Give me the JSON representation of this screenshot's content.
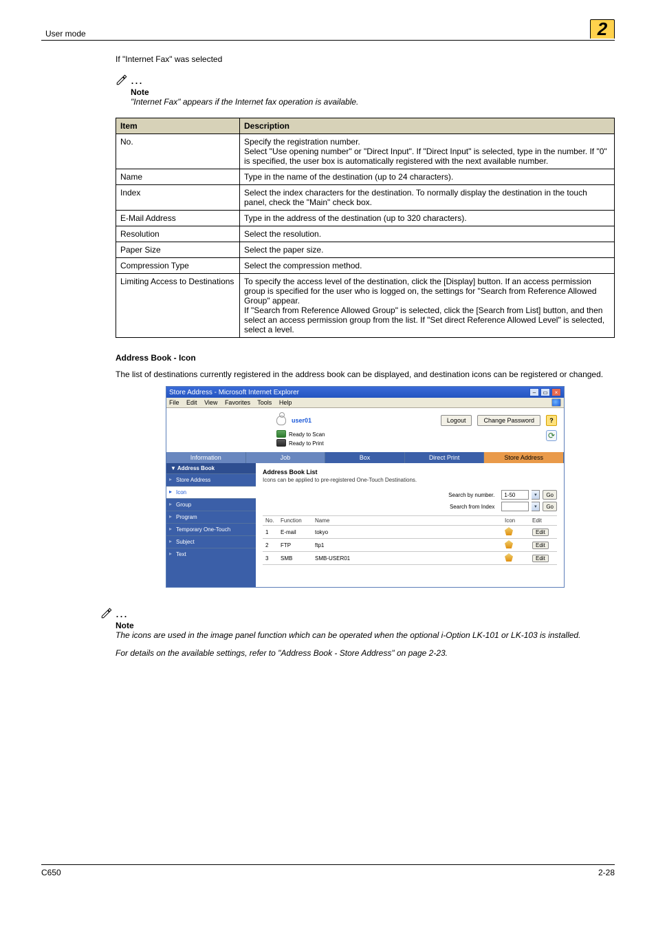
{
  "header": {
    "breadcrumb": "User mode",
    "chapter": "2"
  },
  "intro": "If \"Internet Fax\" was selected",
  "note1": {
    "label": "Note",
    "text": "\"Internet Fax\" appears if the Internet fax operation is available."
  },
  "table": {
    "head_item": "Item",
    "head_desc": "Description",
    "rows": [
      {
        "item": "No.",
        "desc": "Specify the registration number.\nSelect \"Use opening number\" or \"Direct Input\". If \"Direct Input\" is selected, type in the number. If \"0\" is specified, the user box is automatically registered with the next available number."
      },
      {
        "item": "Name",
        "desc": "Type in the name of the destination (up to 24 characters)."
      },
      {
        "item": "Index",
        "desc": "Select the index characters for the destination. To normally display the destination in the touch panel, check the \"Main\" check box."
      },
      {
        "item": "E-Mail Address",
        "desc": "Type in the address of the destination (up to 320 characters)."
      },
      {
        "item": "Resolution",
        "desc": "Select the resolution."
      },
      {
        "item": "Paper Size",
        "desc": "Select the paper size."
      },
      {
        "item": "Compression Type",
        "desc": "Select the compression method."
      },
      {
        "item": "Limiting Access to Destinations",
        "desc": "To specify the access level of the destination, click the [Display] button. If an access permission group is specified for the user who is logged on, the settings for \"Search from Reference Allowed Group\" appear.\nIf \"Search from Reference Allowed Group\" is selected, click the [Search from List] button, and then select an access permission group from the list. If \"Set direct Reference Allowed Level\" is selected, select a level."
      }
    ]
  },
  "section_heading": "Address Book - Icon",
  "section_para": "The list of destinations currently registered in the address book can be displayed, and destination icons can be registered or changed.",
  "screenshot": {
    "title": "Store Address - Microsoft Internet Explorer",
    "menus": [
      "File",
      "Edit",
      "View",
      "Favorites",
      "Tools",
      "Help"
    ],
    "user": "user01",
    "btn_logout": "Logout",
    "btn_change_pw": "Change Password",
    "status1": "Ready to Scan",
    "status2": "Ready to Print",
    "tabs": [
      "Information",
      "Job",
      "Box",
      "Direct Print",
      "Store Address"
    ],
    "side_head": "▼ Address Book",
    "side_items": [
      "Store Address",
      "Icon",
      "Group",
      "Program",
      "Temporary One-Touch",
      "Subject",
      "Text"
    ],
    "pane_title": "Address Book List",
    "pane_sub": "Icons can be applied to pre-registered One-Touch Destinations.",
    "label_by_number": "Search by number.",
    "label_from_index": "Search from Index",
    "range_value": "1-50",
    "go": "Go",
    "list_head": {
      "no": "No.",
      "func": "Function",
      "name": "Name",
      "icon": "Icon",
      "edit": "Edit"
    },
    "list_rows": [
      {
        "no": "1",
        "func": "E-mail",
        "name": "tokyo"
      },
      {
        "no": "2",
        "func": "FTP",
        "name": "ftp1"
      },
      {
        "no": "3",
        "func": "SMB",
        "name": "SMB-USER01"
      }
    ],
    "edit": "Edit"
  },
  "note2": {
    "label": "Note",
    "line1": "The icons are used in the image panel function which can be operated when the optional i-Option LK-101 or LK-103 is installed.",
    "line2": "For details on the available settings, refer to \"Address Book - Store Address\" on page 2-23."
  },
  "footer": {
    "left": "C650",
    "right": "2-28"
  }
}
